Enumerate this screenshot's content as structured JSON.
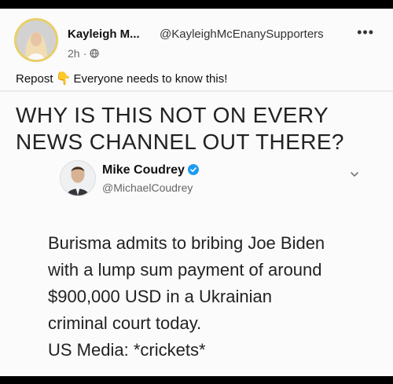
{
  "post": {
    "author_name": "Kayleigh M...",
    "author_handle": "@KayleighMcEnanySupporters",
    "time": "2h",
    "more_icon": "more-dots-icon",
    "privacy_icon": "globe-icon",
    "repost_label": "Repost",
    "repost_emoji": "👇",
    "repost_text": "Everyone needs to know this!"
  },
  "headline": {
    "line1": "WHY IS THIS NOT ON EVERY",
    "line2": "NEWS CHANNEL OUT THERE?"
  },
  "tweet": {
    "author_name": "Mike Coudrey",
    "author_handle": "@MichaelCoudrey",
    "verified": true,
    "body_lines": [
      "Burisma admits to bribing Joe Biden",
      "with a lump sum payment of around",
      "$900,000 USD in a Ukrainian",
      "criminal court today.",
      "US Media: *crickets*"
    ]
  },
  "colors": {
    "verified_blue": "#1d9bf0",
    "avatar_ring": "#e8cf6a"
  }
}
